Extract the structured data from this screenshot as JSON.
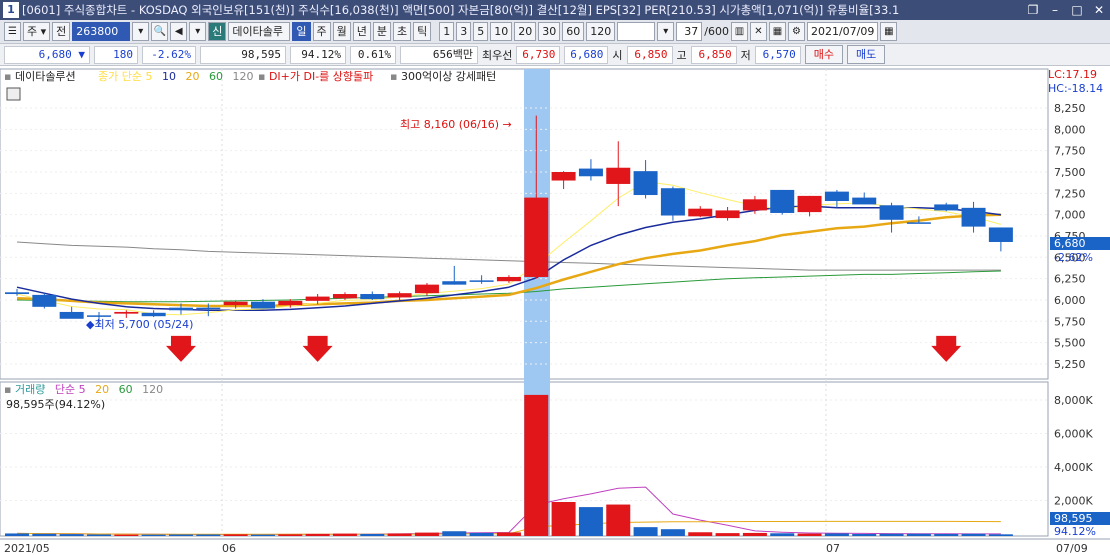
{
  "title_bar": {
    "number": "1",
    "title": "[0601] 주식종합차트 - KOSDAQ 외국인보유[151(천)] 주식수[16,038(천)] 액면[500] 자본금[80(억)] 결산[12월] EPS[32] PER[210.53] 시가총액[1,071(억)] 유통비율[33.1"
  },
  "toolbar": {
    "market": "주",
    "type": "전",
    "code": "263800",
    "new_badge": "신",
    "stock_name": "데이타솔루",
    "periods": [
      "일",
      "주",
      "월",
      "년",
      "분",
      "초",
      "틱"
    ],
    "intervals": [
      "1",
      "3",
      "5",
      "10",
      "20",
      "30",
      "60",
      "120"
    ],
    "count": "37",
    "count_total": "/600",
    "date": "2021/07/09"
  },
  "quote": {
    "price": "6,680",
    "change": "180",
    "change_pct": "-2.62%",
    "volume": "98,595",
    "vol_ratio": "94.12%",
    "turnover": "0.61%",
    "amount": "656백만",
    "best_label": "최우선",
    "best": "6,730",
    "best2": "6,680",
    "open_label": "시",
    "open": "6,850",
    "high_label": "고",
    "high": "6,850",
    "low_label": "저",
    "low": "6,570",
    "buy_label": "매수",
    "sell_label": "매도"
  },
  "colors": {
    "up": "#e0161b",
    "down": "#1a63c7",
    "ma5": "#ffee66",
    "ma10": "#1a2c9c",
    "ma20": "#e8a814",
    "ma60": "#2a9a3a",
    "ma120": "#888888",
    "vol_ma": "#c040c0",
    "highlight": "#9ec8f2"
  },
  "chart_data": {
    "type": "candlestick",
    "price_legend": {
      "name": "데이타솔루션",
      "ma_label": "종가 단순 5",
      "ma_periods": [
        "10",
        "20",
        "60",
        "120"
      ],
      "signal": "DI+가 DI-를 상향돌파",
      "pattern": "300억이상 강세패턴"
    },
    "axis_right_labels": [
      "8,250",
      "8,000",
      "7,750",
      "7,500",
      "7,250",
      "7,000",
      "6,750",
      "6,500",
      "6,250",
      "6,000",
      "5,750",
      "5,500",
      "5,250"
    ],
    "lc": "LC:17.19",
    "hc": "HC:-18.14",
    "current_price_tag": "6,680",
    "current_pct_tag": "-2.62%",
    "high_marker": "최고 8,160 (06/16)",
    "low_marker": "최저 5,700 (05/24)",
    "candles": [
      {
        "o": 6090,
        "h": 6130,
        "l": 6050,
        "c": 6070
      },
      {
        "o": 6060,
        "h": 6080,
        "l": 5900,
        "c": 5920
      },
      {
        "o": 5860,
        "h": 5920,
        "l": 5790,
        "c": 5780
      },
      {
        "o": 5820,
        "h": 5860,
        "l": 5700,
        "c": 5810
      },
      {
        "o": 5840,
        "h": 5880,
        "l": 5790,
        "c": 5860
      },
      {
        "o": 5850,
        "h": 5880,
        "l": 5800,
        "c": 5810
      },
      {
        "o": 5910,
        "h": 5960,
        "l": 5830,
        "c": 5880
      },
      {
        "o": 5910,
        "h": 5960,
        "l": 5810,
        "c": 5900
      },
      {
        "o": 5940,
        "h": 5990,
        "l": 5900,
        "c": 5980
      },
      {
        "o": 5980,
        "h": 6010,
        "l": 5900,
        "c": 5900
      },
      {
        "o": 5940,
        "h": 6010,
        "l": 5910,
        "c": 5990
      },
      {
        "o": 5990,
        "h": 6070,
        "l": 5950,
        "c": 6040
      },
      {
        "o": 6020,
        "h": 6090,
        "l": 6000,
        "c": 6070
      },
      {
        "o": 6070,
        "h": 6100,
        "l": 6000,
        "c": 6010
      },
      {
        "o": 6030,
        "h": 6100,
        "l": 6000,
        "c": 6080
      },
      {
        "o": 6080,
        "h": 6200,
        "l": 6050,
        "c": 6180
      },
      {
        "o": 6220,
        "h": 6400,
        "l": 6180,
        "c": 6180
      },
      {
        "o": 6230,
        "h": 6290,
        "l": 6190,
        "c": 6220
      },
      {
        "o": 6220,
        "h": 6290,
        "l": 6200,
        "c": 6270
      },
      {
        "o": 6270,
        "h": 8160,
        "l": 6250,
        "c": 7200
      },
      {
        "o": 7400,
        "h": 7510,
        "l": 7300,
        "c": 7500
      },
      {
        "o": 7540,
        "h": 7650,
        "l": 7400,
        "c": 7450
      },
      {
        "o": 7360,
        "h": 7860,
        "l": 7100,
        "c": 7550
      },
      {
        "o": 7510,
        "h": 7640,
        "l": 7190,
        "c": 7230
      },
      {
        "o": 7310,
        "h": 7330,
        "l": 6930,
        "c": 6990
      },
      {
        "o": 6980,
        "h": 7100,
        "l": 6970,
        "c": 7070
      },
      {
        "o": 6960,
        "h": 7090,
        "l": 6930,
        "c": 7050
      },
      {
        "o": 7050,
        "h": 7220,
        "l": 7010,
        "c": 7180
      },
      {
        "o": 7290,
        "h": 7290,
        "l": 7000,
        "c": 7020
      },
      {
        "o": 7030,
        "h": 7220,
        "l": 6980,
        "c": 7220
      },
      {
        "o": 7270,
        "h": 7290,
        "l": 7080,
        "c": 7160
      },
      {
        "o": 7200,
        "h": 7260,
        "l": 7130,
        "c": 7120
      },
      {
        "o": 7110,
        "h": 7140,
        "l": 6790,
        "c": 6940
      },
      {
        "o": 6910,
        "h": 6980,
        "l": 6900,
        "c": 6900
      },
      {
        "o": 7120,
        "h": 7140,
        "l": 7040,
        "c": 7050
      },
      {
        "o": 7080,
        "h": 7150,
        "l": 6790,
        "c": 6860
      },
      {
        "o": 6850,
        "h": 6850,
        "l": 6570,
        "c": 6680
      }
    ],
    "ma10": [
      6150,
      6080,
      6010,
      5960,
      5920,
      5900,
      5890,
      5880,
      5880,
      5880,
      5890,
      5910,
      5930,
      5960,
      5990,
      6020,
      6060,
      6100,
      6150,
      6260,
      6470,
      6640,
      6760,
      6850,
      6910,
      6950,
      7000,
      7050,
      7090,
      7100,
      7080,
      7080,
      7080,
      7080,
      7070,
      7040,
      7000
    ],
    "ma20": [
      6020,
      6010,
      5990,
      5970,
      5960,
      5950,
      5940,
      5930,
      5930,
      5930,
      5940,
      5950,
      5960,
      5970,
      5990,
      6000,
      6020,
      6040,
      6060,
      6140,
      6240,
      6330,
      6420,
      6490,
      6540,
      6580,
      6640,
      6690,
      6760,
      6800,
      6840,
      6860,
      6900,
      6930,
      6970,
      6990,
      7000
    ],
    "ma60": [
      6000,
      5995,
      5990,
      5985,
      5980,
      5980,
      5980,
      5985,
      5990,
      5995,
      6000,
      6010,
      6020,
      6030,
      6040,
      6050,
      6060,
      6070,
      6080,
      6100,
      6130,
      6150,
      6170,
      6190,
      6210,
      6230,
      6250,
      6260,
      6270,
      6280,
      6290,
      6300,
      6300,
      6310,
      6320,
      6330,
      6340
    ],
    "ma120": [
      6680,
      6660,
      6640,
      6630,
      6620,
      6600,
      6590,
      6570,
      6560,
      6550,
      6540,
      6530,
      6520,
      6510,
      6500,
      6490,
      6480,
      6470,
      6460,
      6450,
      6440,
      6430,
      6420,
      6410,
      6400,
      6390,
      6380,
      6370,
      6360,
      6350,
      6350,
      6350,
      6350,
      6350,
      6350,
      6350,
      6350
    ],
    "volume": {
      "legend_name": "거래량",
      "ma_label": "단순 5",
      "ma_periods": [
        "20",
        "60",
        "120"
      ],
      "current": "98,595주(94.12%)",
      "axis_right_labels": [
        "8,000K",
        "6,000K",
        "4,000K",
        "2,000K"
      ],
      "tag_value": "98,595",
      "tag_pct": "94.12%",
      "values": [
        150,
        130,
        110,
        90,
        80,
        80,
        90,
        90,
        100,
        80,
        100,
        120,
        140,
        120,
        150,
        200,
        280,
        180,
        210,
        8300,
        2000,
        1700,
        1850,
        520,
        400,
        220,
        170,
        180,
        160,
        140,
        150,
        120,
        130,
        130,
        120,
        130,
        99
      ]
    },
    "dates": [
      "2021/05",
      "06",
      "07",
      "07/09"
    ]
  }
}
